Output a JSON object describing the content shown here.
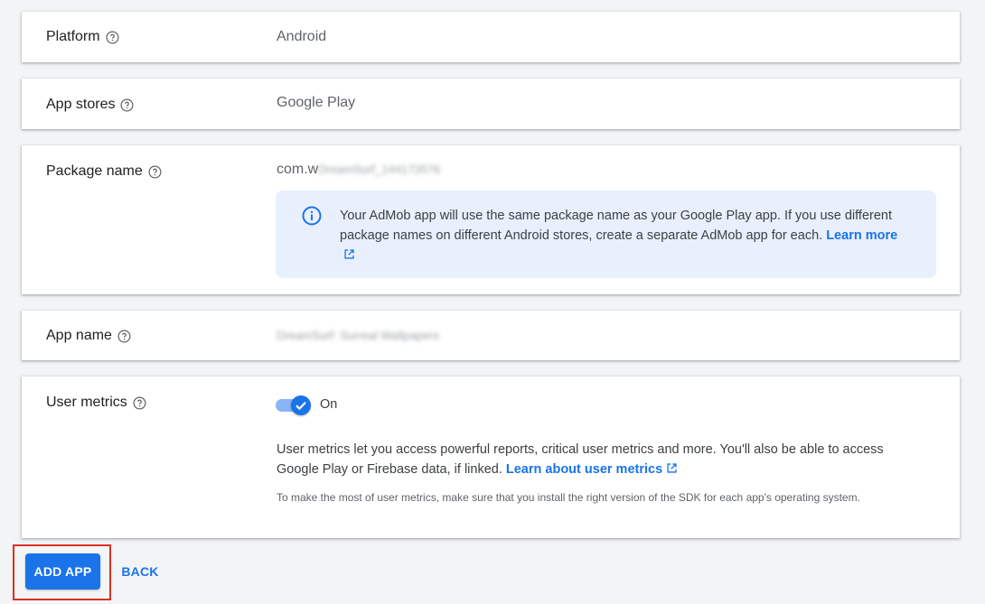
{
  "platform": {
    "label": "Platform",
    "value": "Android"
  },
  "app_stores": {
    "label": "App stores",
    "value": "Google Play"
  },
  "package_name": {
    "label": "Package name",
    "value_visible": "com.w",
    "value_obscured": "DreamSurf_144173576",
    "info": {
      "text": "Your AdMob app will use the same package name as your Google Play app. If you use different package names on different Android stores, create a separate AdMob app for each.",
      "link_label": "Learn more"
    }
  },
  "app_name": {
    "label": "App name",
    "value_obscured": "DreamSurf: Surreal Wallpapers"
  },
  "user_metrics": {
    "label": "User metrics",
    "toggle_state": "On",
    "enabled": true,
    "description": "User metrics let you access powerful reports, critical user metrics and more. You'll also be able to access Google Play or Firebase data, if linked.",
    "link_label": "Learn about user metrics",
    "note": "To make the most of user metrics, make sure that you install the right version of the SDK for each app's operating system."
  },
  "actions": {
    "add_app_label": "ADD APP",
    "back_label": "BACK"
  },
  "colors": {
    "accent": "#1a73e8",
    "info_bg": "#e8f0fe",
    "highlight": "#d93025"
  }
}
